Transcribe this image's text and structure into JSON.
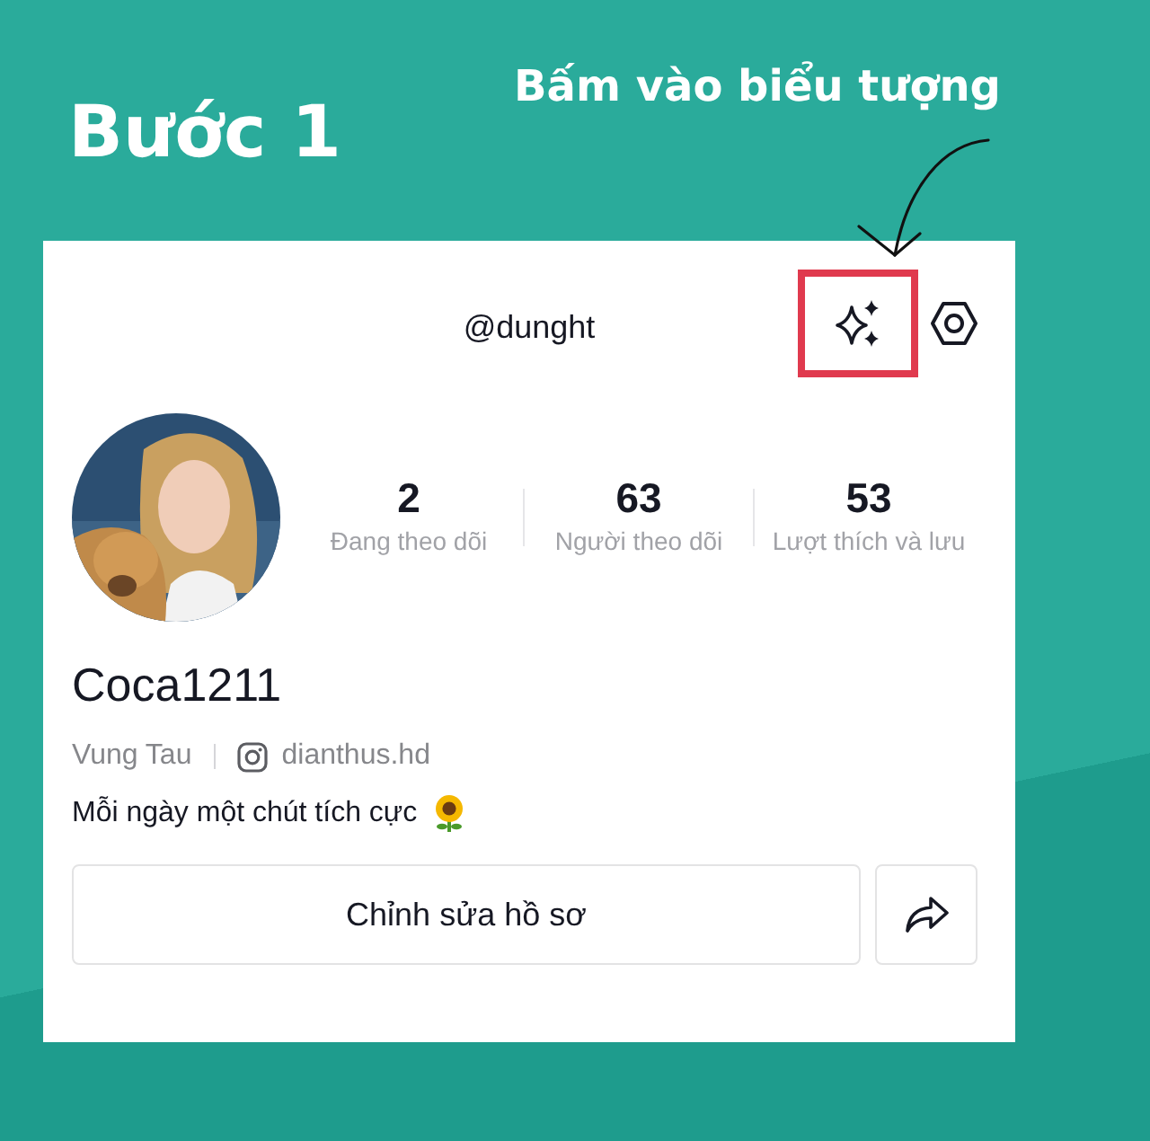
{
  "annotation": {
    "step": "Bước 1",
    "instruction": "Bấm vào biểu tượng"
  },
  "header": {
    "username": "@dunght",
    "actions": [
      {
        "kind": "sparkle",
        "highlighted": true
      },
      {
        "kind": "settings",
        "highlighted": false
      }
    ]
  },
  "profile": {
    "name": "Coca1211",
    "location": "Vung Tau",
    "instagram": "dianthus.hd",
    "bio": "Mỗi ngày một chút tích cực"
  },
  "stats": [
    {
      "value": "2",
      "label": "Đang theo dõi"
    },
    {
      "value": "63",
      "label": "Người theo dõi"
    },
    {
      "value": "53",
      "label": "Lượt thích và lưu"
    }
  ],
  "buttons": {
    "edit": "Chỉnh sửa hồ sơ"
  }
}
